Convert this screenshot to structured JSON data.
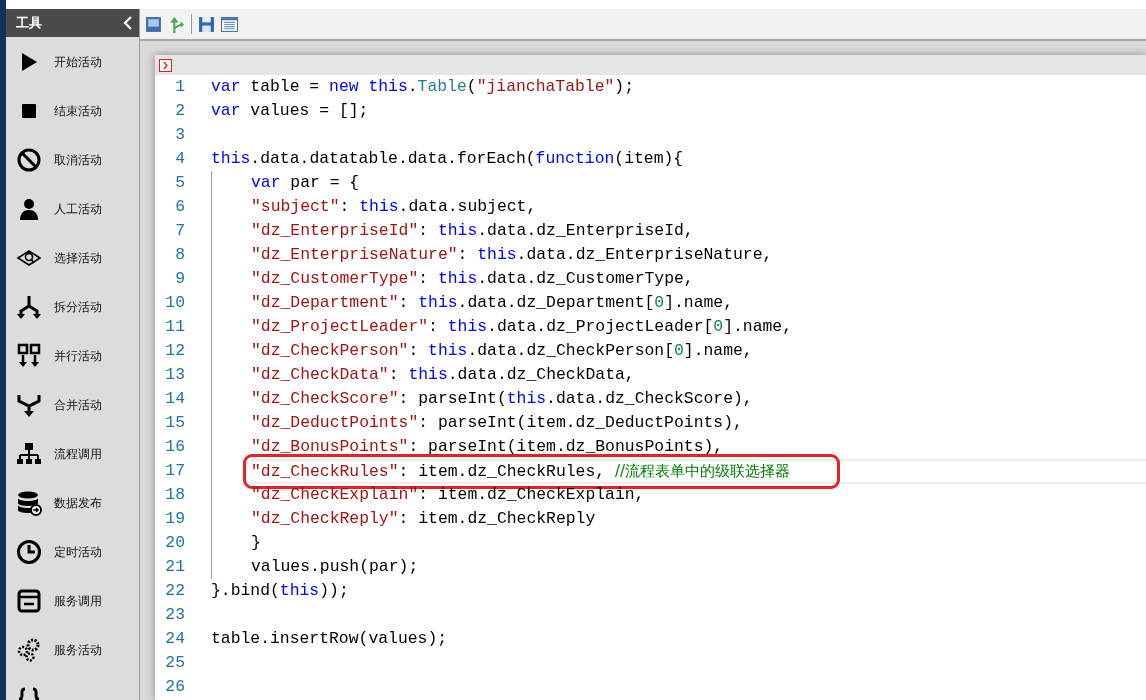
{
  "sidebar": {
    "title": "工具",
    "items": [
      {
        "label": "开始活动"
      },
      {
        "label": "结束活动"
      },
      {
        "label": "取消活动"
      },
      {
        "label": "人工活动"
      },
      {
        "label": "选择活动"
      },
      {
        "label": "拆分活动"
      },
      {
        "label": "并行活动"
      },
      {
        "label": "合并活动"
      },
      {
        "label": "流程调用"
      },
      {
        "label": "数据发布"
      },
      {
        "label": "定时活动"
      },
      {
        "label": "服务调用"
      },
      {
        "label": "服务活动"
      }
    ]
  },
  "editor": {
    "lines": [
      {
        "number": "1",
        "indented": false,
        "active": false,
        "outlined": false,
        "tokens": [
          {
            "kind": "keyword",
            "text": "var"
          },
          {
            "kind": "plain",
            "text": " table = "
          },
          {
            "kind": "keyword",
            "text": "new this"
          },
          {
            "kind": "plain",
            "text": "."
          },
          {
            "kind": "type",
            "text": "Table"
          },
          {
            "kind": "plain",
            "text": "("
          },
          {
            "kind": "string",
            "text": "\"jianchaTable\""
          },
          {
            "kind": "plain",
            "text": ");"
          }
        ]
      },
      {
        "number": "2",
        "indented": false,
        "active": false,
        "outlined": false,
        "tokens": [
          {
            "kind": "keyword",
            "text": "var"
          },
          {
            "kind": "plain",
            "text": " values = [];"
          }
        ]
      },
      {
        "number": "3",
        "indented": false,
        "active": false,
        "outlined": false
      },
      {
        "number": "4",
        "indented": false,
        "active": false,
        "outlined": false,
        "tokens": [
          {
            "kind": "keyword",
            "text": "this"
          },
          {
            "kind": "plain",
            "text": ".data.datatable.data.forEach("
          },
          {
            "kind": "keyword",
            "text": "function"
          },
          {
            "kind": "plain",
            "text": "(item){"
          }
        ]
      },
      {
        "number": "5",
        "indented": true,
        "active": false,
        "outlined": false,
        "tokens": [
          {
            "kind": "keyword",
            "text": "var"
          },
          {
            "kind": "plain",
            "text": " par = {"
          }
        ]
      },
      {
        "number": "6",
        "indented": true,
        "active": false,
        "outlined": false,
        "tokens": [
          {
            "kind": "string",
            "text": "\"subject\""
          },
          {
            "kind": "plain",
            "text": ": "
          },
          {
            "kind": "keyword",
            "text": "this"
          },
          {
            "kind": "plain",
            "text": ".data.subject,"
          }
        ]
      },
      {
        "number": "7",
        "indented": true,
        "active": false,
        "outlined": false,
        "tokens": [
          {
            "kind": "string",
            "text": "\"dz_EnterpriseId\""
          },
          {
            "kind": "plain",
            "text": ": "
          },
          {
            "kind": "keyword",
            "text": "this"
          },
          {
            "kind": "plain",
            "text": ".data.dz_EnterpriseId,"
          }
        ]
      },
      {
        "number": "8",
        "indented": true,
        "active": false,
        "outlined": false,
        "tokens": [
          {
            "kind": "string",
            "text": "\"dz_EnterpriseNature\""
          },
          {
            "kind": "plain",
            "text": ": "
          },
          {
            "kind": "keyword",
            "text": "this"
          },
          {
            "kind": "plain",
            "text": ".data.dz_EnterpriseNature,"
          }
        ]
      },
      {
        "number": "9",
        "indented": true,
        "active": false,
        "outlined": false,
        "tokens": [
          {
            "kind": "string",
            "text": "\"dz_CustomerType\""
          },
          {
            "kind": "plain",
            "text": ": "
          },
          {
            "kind": "keyword",
            "text": "this"
          },
          {
            "kind": "plain",
            "text": ".data.dz_CustomerType,"
          }
        ]
      },
      {
        "number": "10",
        "indented": true,
        "active": false,
        "outlined": false,
        "tokens": [
          {
            "kind": "string",
            "text": "\"dz_Department\""
          },
          {
            "kind": "plain",
            "text": ": "
          },
          {
            "kind": "keyword",
            "text": "this"
          },
          {
            "kind": "plain",
            "text": ".data.dz_Department["
          },
          {
            "kind": "number",
            "text": "0"
          },
          {
            "kind": "plain",
            "text": "].name,"
          }
        ]
      },
      {
        "number": "11",
        "indented": true,
        "active": false,
        "outlined": false,
        "tokens": [
          {
            "kind": "string",
            "text": "\"dz_ProjectLeader\""
          },
          {
            "kind": "plain",
            "text": ": "
          },
          {
            "kind": "keyword",
            "text": "this"
          },
          {
            "kind": "plain",
            "text": ".data.dz_ProjectLeader["
          },
          {
            "kind": "number",
            "text": "0"
          },
          {
            "kind": "plain",
            "text": "].name,"
          }
        ]
      },
      {
        "number": "12",
        "indented": true,
        "active": false,
        "outlined": false,
        "tokens": [
          {
            "kind": "string",
            "text": "\"dz_CheckPerson\""
          },
          {
            "kind": "plain",
            "text": ": "
          },
          {
            "kind": "keyword",
            "text": "this"
          },
          {
            "kind": "plain",
            "text": ".data.dz_CheckPerson["
          },
          {
            "kind": "number",
            "text": "0"
          },
          {
            "kind": "plain",
            "text": "].name,"
          }
        ]
      },
      {
        "number": "13",
        "indented": true,
        "active": false,
        "outlined": false,
        "tokens": [
          {
            "kind": "string",
            "text": "\"dz_CheckData\""
          },
          {
            "kind": "plain",
            "text": ": "
          },
          {
            "kind": "keyword",
            "text": "this"
          },
          {
            "kind": "plain",
            "text": ".data.dz_CheckData,"
          }
        ]
      },
      {
        "number": "14",
        "indented": true,
        "active": false,
        "outlined": false,
        "tokens": [
          {
            "kind": "string",
            "text": "\"dz_CheckScore\""
          },
          {
            "kind": "plain",
            "text": ": parseInt("
          },
          {
            "kind": "keyword",
            "text": "this"
          },
          {
            "kind": "plain",
            "text": ".data.dz_CheckScore),"
          }
        ]
      },
      {
        "number": "15",
        "indented": true,
        "active": false,
        "outlined": false,
        "tokens": [
          {
            "kind": "string",
            "text": "\"dz_DeductPoints\""
          },
          {
            "kind": "plain",
            "text": ": parseInt(item.dz_DeductPoints),"
          }
        ]
      },
      {
        "number": "16",
        "indented": true,
        "active": false,
        "outlined": false,
        "tokens": [
          {
            "kind": "string",
            "text": "\"dz_BonusPoints\""
          },
          {
            "kind": "plain",
            "text": ": parseInt(item.dz_BonusPoints),"
          }
        ]
      },
      {
        "number": "17",
        "indented": true,
        "active": true,
        "outlined": true,
        "tokens": [
          {
            "kind": "string",
            "text": "\"dz_CheckRules\""
          },
          {
            "kind": "plain",
            "text": ": item.dz_CheckRules, "
          },
          {
            "kind": "comment",
            "text": "//流程表单中的级联选择器"
          }
        ]
      },
      {
        "number": "18",
        "indented": true,
        "active": false,
        "outlined": false,
        "tokens": [
          {
            "kind": "string",
            "text": "\"dz_CheckExplain\""
          },
          {
            "kind": "plain",
            "text": ": item.dz_CheckExplain,"
          }
        ]
      },
      {
        "number": "19",
        "indented": true,
        "active": false,
        "outlined": false,
        "tokens": [
          {
            "kind": "string",
            "text": "\"dz_CheckReply\""
          },
          {
            "kind": "plain",
            "text": ": item.dz_CheckReply"
          }
        ]
      },
      {
        "number": "20",
        "indented": true,
        "active": false,
        "outlined": false,
        "tokens": [
          {
            "kind": "plain",
            "text": "}"
          }
        ]
      },
      {
        "number": "21",
        "indented": true,
        "active": false,
        "outlined": false,
        "tokens": [
          {
            "kind": "plain",
            "text": "values.push(par);"
          }
        ]
      },
      {
        "number": "22",
        "indented": false,
        "active": false,
        "outlined": false,
        "tokens": [
          {
            "kind": "plain",
            "text": "}.bind("
          },
          {
            "kind": "keyword",
            "text": "this"
          },
          {
            "kind": "plain",
            "text": "));"
          }
        ]
      },
      {
        "number": "23",
        "indented": false,
        "active": false,
        "outlined": false
      },
      {
        "number": "24",
        "indented": false,
        "active": false,
        "outlined": false,
        "tokens": [
          {
            "kind": "plain",
            "text": "table.insertRow(values);"
          }
        ]
      },
      {
        "number": "25",
        "indented": false,
        "active": false,
        "outlined": false
      },
      {
        "number": "26",
        "indented": false,
        "active": false,
        "outlined": false
      }
    ]
  }
}
